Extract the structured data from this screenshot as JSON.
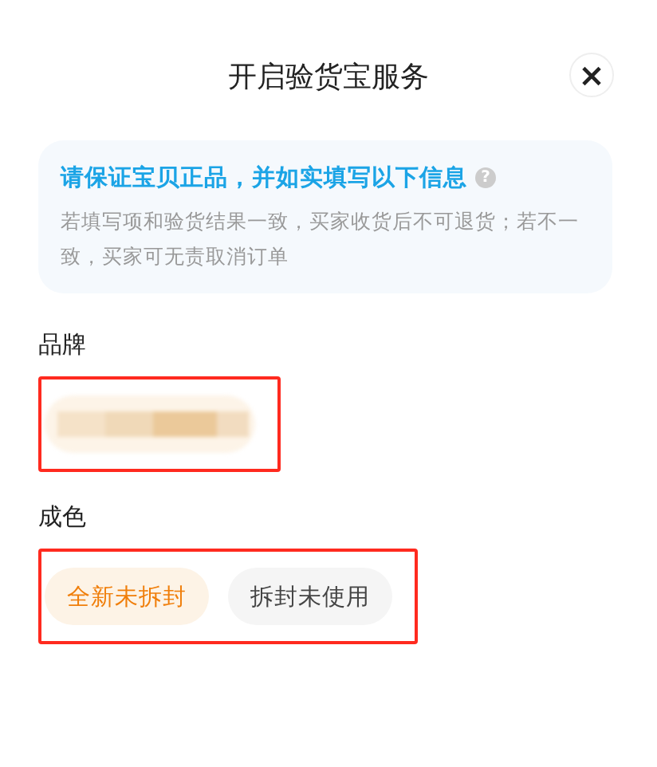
{
  "title": "开启验货宝服务",
  "close": "×",
  "notice": {
    "headline": "请保证宝贝正品，并如实填写以下信息",
    "help": "?",
    "body": "若填写项和验货结果一致，买家收货后不可退货；若不一致，买家可无责取消订单"
  },
  "sections": [
    {
      "label": "品牌",
      "kind": "blurred",
      "highlighted": true
    },
    {
      "label": "成色",
      "kind": "chips",
      "highlighted": true,
      "options": [
        {
          "label": "全新未拆封",
          "selected": true
        },
        {
          "label": "拆封未使用",
          "selected": false
        }
      ]
    }
  ]
}
